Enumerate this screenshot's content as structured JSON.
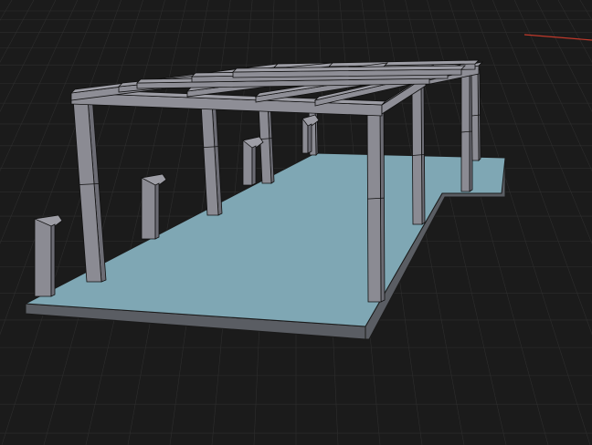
{
  "viewport": {
    "background": "#1b1b1b",
    "grid_color": "#2e2e2e",
    "x_axis_color": "#c0392b"
  },
  "scene": {
    "floor_top_color": "#7fa7b4",
    "floor_side_color": "#5a5d63",
    "floor_edge_color": "#1a1a1a",
    "column_color": "#8b8b93",
    "column_dark_color": "#6c6c74",
    "beam_color": "#8e8e96",
    "beam_top_color": "#9d9da5",
    "wire_color": "#101010"
  }
}
